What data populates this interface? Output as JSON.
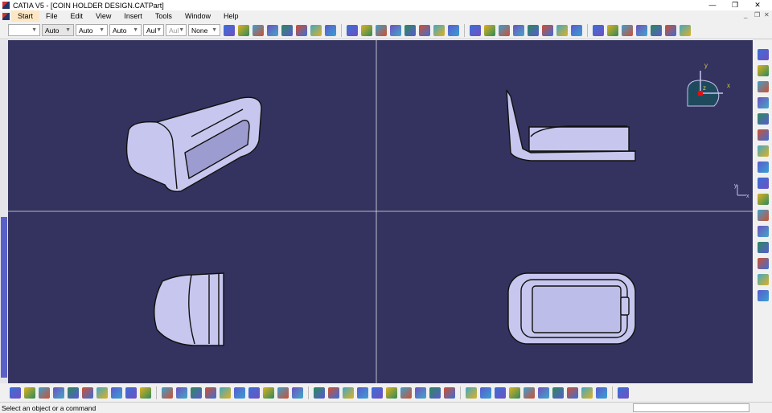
{
  "window": {
    "title": "CATIA V5 - [COIN HOLDER DESIGN.CATPart]",
    "minimize": "—",
    "restore": "❐",
    "close": "✕"
  },
  "menu": [
    "Start",
    "File",
    "Edit",
    "View",
    "Insert",
    "Tools",
    "Window",
    "Help"
  ],
  "graphic_props": {
    "color": "",
    "line_type": "Auto",
    "thickness": "Auto",
    "point": "Auto",
    "layer": "Aul",
    "layer2": "Aul",
    "render": "None"
  },
  "compass": {
    "x": "x",
    "y": "y",
    "z": "z"
  },
  "axis_small": {
    "y": "y",
    "x": "x"
  },
  "status": {
    "message": "Select an object or a command",
    "command_input": ""
  },
  "colors": {
    "background": "#34335f",
    "part": "#c6c6ee",
    "accent": "#5960c8"
  },
  "top_icons": [
    "brush-icon",
    "painter-icon",
    "point-icon",
    "line-icon",
    "plane-icon",
    "projection-icon",
    "intersection-icon",
    "sketch-icon",
    "circle-icon",
    "spline-icon",
    "extrude-icon",
    "revolve-icon",
    "sweep-icon",
    "fill-icon",
    "loft-icon",
    "blend-icon",
    "join-icon",
    "split-icon",
    "trim-icon",
    "fillet-icon",
    "chamfer-icon",
    "translate-icon",
    "rotate-icon",
    "axis-icon",
    "grid-icon",
    "pad-icon",
    "pocket-icon",
    "shaft-icon",
    "groove-icon",
    "hole-icon",
    "rib-icon"
  ],
  "bottom_icons": [
    "new-icon",
    "open-icon",
    "save-icon",
    "print-icon",
    "cut-icon",
    "copy-icon",
    "paste-icon",
    "undo-icon",
    "redo-icon",
    "whats-this-icon",
    "formula-icon",
    "comment-icon",
    "knowledge-icon",
    "table-icon",
    "tree-icon",
    "lock-icon",
    "parameter-icon",
    "fly-icon",
    "fit-all-icon",
    "pan-icon",
    "rotate-view-icon",
    "zoom-in-icon",
    "zoom-out-icon",
    "normal-view-icon",
    "iso-view-icon",
    "views-icon",
    "render-style-icon",
    "hide-show-icon",
    "swap-icon",
    "measure-icon",
    "analysis-icon",
    "draft-analysis-icon",
    "curvature-icon",
    "apply-material-icon",
    "publish-icon",
    "catalog-icon",
    "update-icon",
    "snap-icon",
    "axis-system-icon",
    "compass-icon",
    "grid-view-icon"
  ],
  "right_icons": [
    "select-icon",
    "sketcher-icon",
    "constraint-icon",
    "pad-icon",
    "pocket-icon",
    "shaft-icon",
    "hole-icon",
    "rib-icon",
    "slot-icon",
    "stiffener-icon",
    "loft-icon",
    "remove-icon",
    "shell-icon",
    "thickness-icon",
    "boolean-icon",
    "measure-icon"
  ]
}
